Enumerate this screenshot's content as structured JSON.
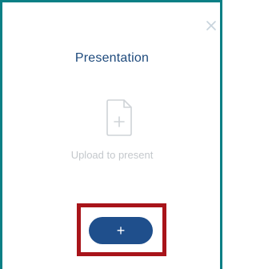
{
  "panel": {
    "title": "Presentation",
    "upload_text": "Upload to present",
    "add_button_label": "+",
    "close_icon": "close-icon",
    "document_icon": "document-add-icon"
  },
  "colors": {
    "frame": "#0a7f85",
    "title": "#1e4a7c",
    "button": "#1f4f8c",
    "highlight": "#a8141a",
    "muted": "#c4c8cc"
  }
}
